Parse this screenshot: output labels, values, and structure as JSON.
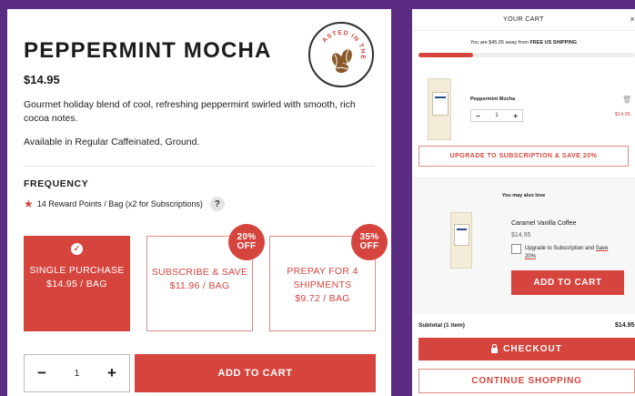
{
  "product": {
    "title": "PEPPERMINT MOCHA",
    "price": "$14.95",
    "description": "Gourmet holiday blend of cool, refreshing peppermint swirled with smooth, rich cocoa notes.",
    "availability": "Available in Regular Caffeinated, Ground.",
    "badge_text": "ROASTED IN THE US",
    "frequency_label": "FREQUENCY",
    "reward_text": "14 Reward Points / Bag (x2 for Subscriptions)",
    "help_label": "?",
    "options": [
      {
        "name": "SINGLE PURCHASE",
        "price": "$14.95 / BAG",
        "selected": true
      },
      {
        "name": "SUBSCRIBE & SAVE",
        "price": "$11.96 / BAG",
        "badge_top": "20%",
        "badge_bottom": "OFF"
      },
      {
        "name": "PREPAY FOR 4 SHIPMENTS",
        "price": "$9.72 / BAG",
        "badge_top": "35%",
        "badge_bottom": "OFF"
      }
    ],
    "quantity": "1",
    "minus_label": "−",
    "plus_label": "+",
    "add_to_cart": "ADD TO CART"
  },
  "cart": {
    "title": "YOUR CART",
    "close_label": "×",
    "shipping_message_prefix": "You are $45.05 away from ",
    "shipping_message_bold": "FREE US SHIPPING",
    "shipping_progress": 0.25,
    "item": {
      "name": "Peppermint Mocha",
      "quantity": "1",
      "price": "$14.95"
    },
    "minus_label": "−",
    "plus_label": "+",
    "upgrade_button": "UPGRADE TO SUBSCRIPTION & SAVE 20%",
    "also_love_title": "You may also love",
    "also_item": {
      "name": "Caramel Vanilla Coffee",
      "price": "$14.95",
      "upgrade_text": "Upgrade to Subscription and ",
      "upgrade_save": "Save 20%"
    },
    "also_add_to_cart": "ADD TO CART",
    "subtotal_label": "Subtotal (1 item)",
    "subtotal_value": "$14.95",
    "checkout": "CHECKOUT",
    "continue": "CONTINUE SHOPPING"
  },
  "colors": {
    "brand_red": "#d5453e",
    "background_purple": "#5b2d82"
  },
  "icons": [
    "coffee-beans-icon",
    "star-icon",
    "check-icon",
    "trash-icon",
    "lock-icon",
    "close-icon"
  ]
}
